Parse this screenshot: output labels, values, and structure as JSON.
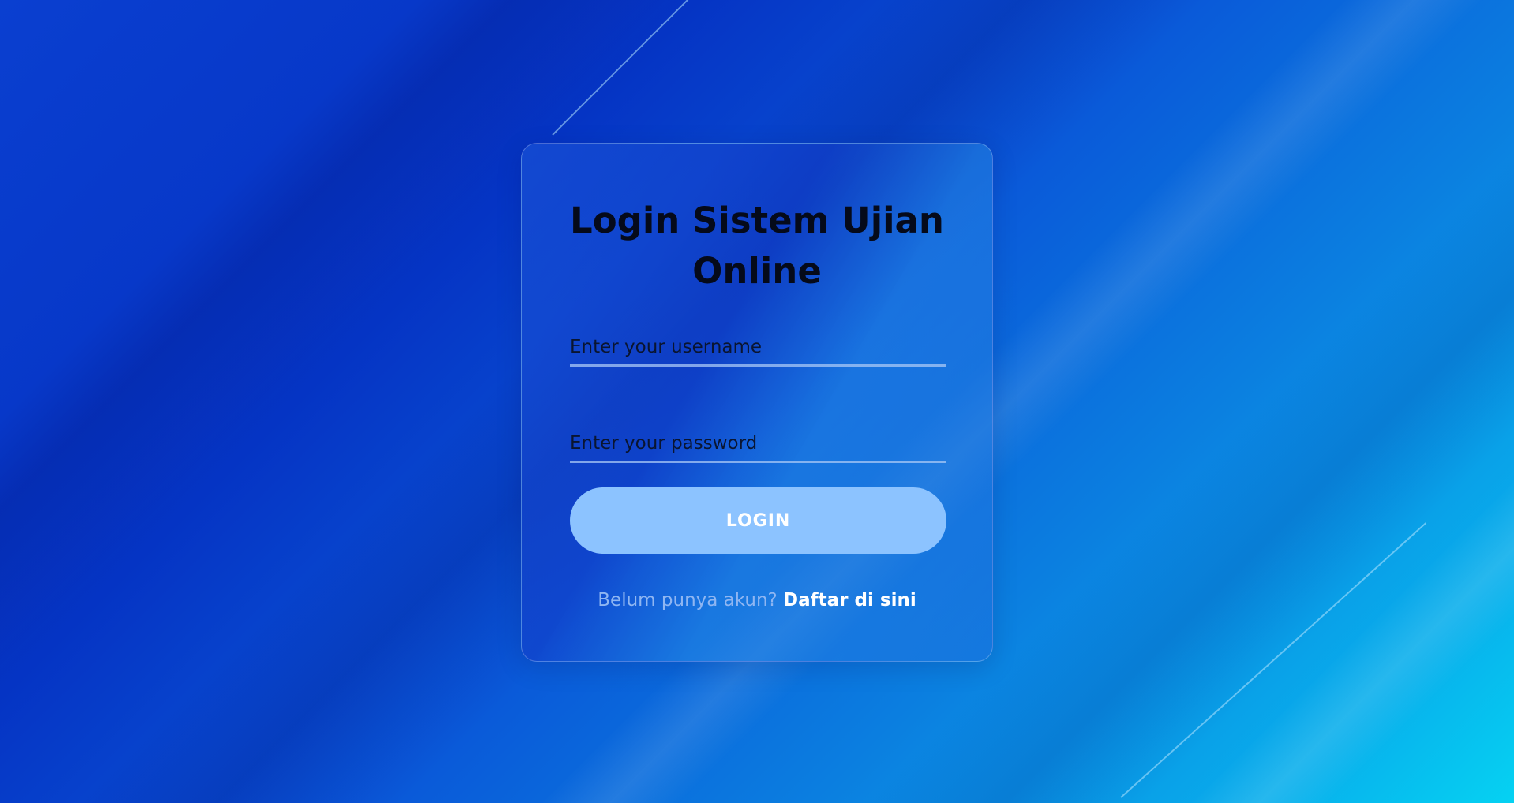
{
  "page": {
    "title": "Login Sistem Ujian Online"
  },
  "form": {
    "username_placeholder": "Enter your username",
    "username_value": "",
    "password_placeholder": "Enter your password",
    "password_value": "",
    "login_label": "LOGIN"
  },
  "register": {
    "prompt": "Belum punya akun?",
    "link_label": "Daftar di sini"
  },
  "colors": {
    "button": "#8cc3ff",
    "title_text": "#050a1a",
    "prompt_text": "#8fb6f2",
    "link_text": "#ffffff"
  }
}
